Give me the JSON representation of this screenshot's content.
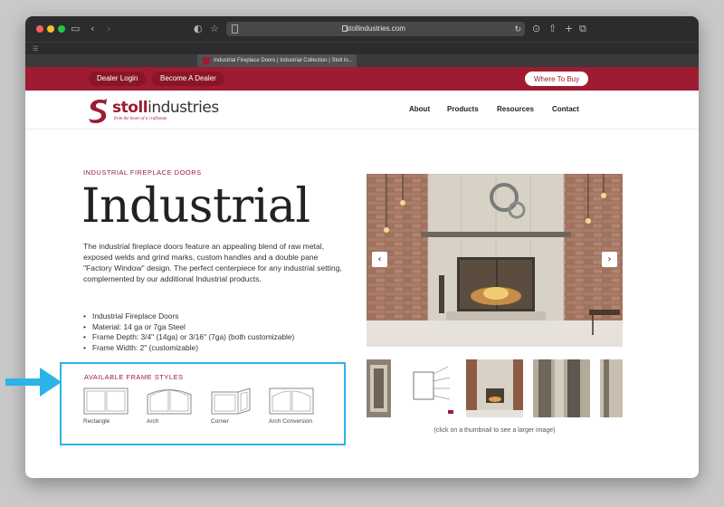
{
  "browser": {
    "url": "stollindustries.com",
    "tab_title": "Industrial Fireplace Doors | Industrial Collection | Stoll In..."
  },
  "topbar": {
    "dealer_login": "Dealer Login",
    "become_dealer": "Become A Dealer",
    "where_to_buy": "Where To Buy"
  },
  "header": {
    "logo_text_bold": "stoll",
    "logo_text": "industries",
    "logo_tagline": "from the heart of a craftsman",
    "nav": [
      "About",
      "Products",
      "Resources",
      "Contact"
    ]
  },
  "product": {
    "eyebrow": "INDUSTRIAL FIREPLACE DOORS",
    "title": "Industrial",
    "description": "The industrial fireplace doors feature an appealing blend of raw metal, exposed welds and grind marks, custom handles and a double pane \"Factory Window\" design. The perfect centerpiece for any industrial setting, complemented by our additional Industrial products.",
    "specs": [
      "Industrial Fireplace Doors",
      "Material: 14 ga or 7ga Steel",
      "Frame Depth: 3/4\" (14ga) or 3/16\" (7ga)  (both customizable)",
      "Frame Width: 2\" (customizable)"
    ],
    "frame_styles_title": "AVAILABLE FRAME STYLES",
    "frame_styles": [
      "Rectangle",
      "Arch",
      "Corner",
      "Arch Conversion"
    ]
  },
  "gallery": {
    "prev_icon": "‹",
    "next_icon": "›",
    "caption": "(click on a thumbnail to see a larger image)"
  },
  "colors": {
    "brand": "#9e1b32",
    "highlight": "#2bb3ea"
  }
}
